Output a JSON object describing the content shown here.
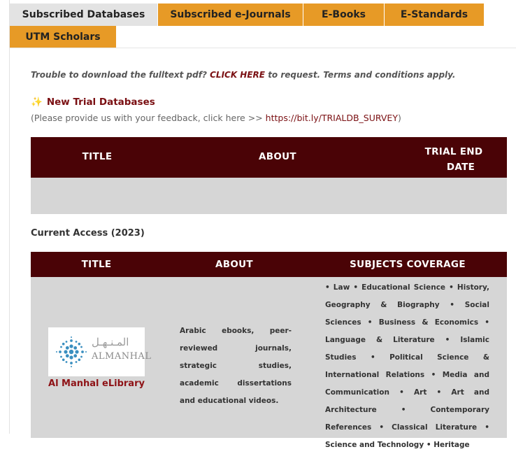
{
  "tabs": [
    {
      "label": "Subscribed Databases",
      "active": true
    },
    {
      "label": "Subscribed e-Journals",
      "active": false
    },
    {
      "label": "E-Books",
      "active": false
    },
    {
      "label": "E-Standards",
      "active": false
    },
    {
      "label": "UTM Scholars",
      "active": false
    }
  ],
  "notice": {
    "prefix": "Trouble to download the fulltext pdf?",
    "link": "CLICK HERE",
    "suffix": "to request. Terms and conditions apply."
  },
  "trial": {
    "icon": "sparkle-icon",
    "title": "New Trial Databases",
    "feedback_prefix": "(Please provide us with your feedback, click here >>",
    "feedback_url": "https://bit.ly/TRIALDB_SURVEY",
    "feedback_suffix": ")",
    "headers": {
      "title": "TITLE",
      "about": "ABOUT",
      "trial_end_line1": "TRIAL END",
      "trial_end_line2": "DATE"
    }
  },
  "current": {
    "heading": "Current Access (2023)",
    "headers": {
      "title": "TITLE",
      "about": "ABOUT",
      "subjects": "SUBJECTS COVERAGE"
    },
    "rows": [
      {
        "logo": {
          "arabic": "المـنـهـل",
          "english": "ALMANHAL"
        },
        "name": "Al Manhal eLibrary",
        "about": "Arabic ebooks, peer-reviewed journals, strategic studies, academic dissertations and educational videos.",
        "subjects": "• Law • Educational Science • History, Geography & Biography • Social Sciences • Business & Economics • Language & Literature • Islamic Studies • Political Science & International Relations • Media and Communication • Art • Art and Architecture • Contemporary References • Classical Literature • Science and Technology • Heritage"
      }
    ]
  },
  "colors": {
    "tab_orange": "#e79a26",
    "tab_active": "#e3e3e3",
    "header_maroon": "#4a0306",
    "link_maroon": "#7a0f12",
    "row_grey": "#d6d6d6"
  }
}
